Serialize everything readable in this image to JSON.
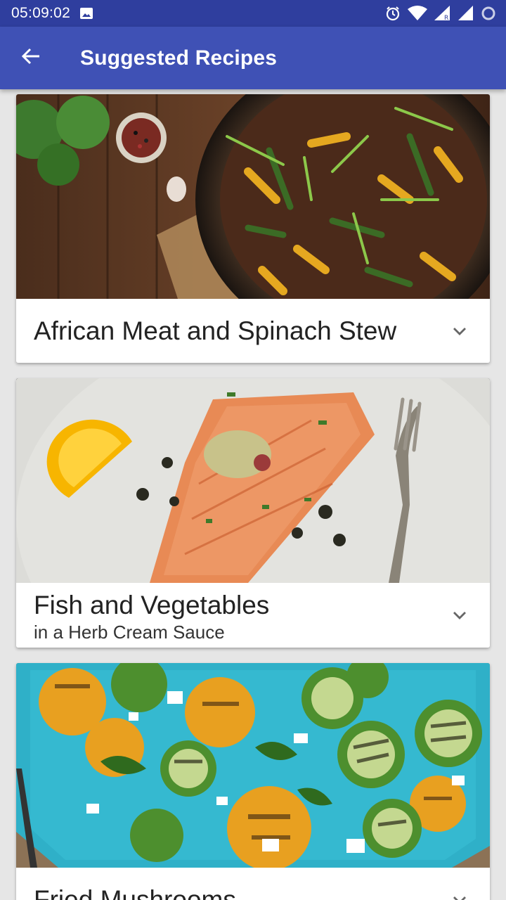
{
  "status_bar": {
    "time": "05:09:02",
    "icons": [
      "image-icon",
      "alarm-icon",
      "wifi-icon",
      "signal-r-icon",
      "signal-icon",
      "sync-circle-icon"
    ]
  },
  "app_bar": {
    "title": "Suggested Recipes",
    "back_icon": "arrow-back-icon"
  },
  "recipes": [
    {
      "title": "African Meat and Spinach Stew",
      "subtitle": "",
      "image": "beef-and-vegetable-stir-fry-photo",
      "expand_icon": "chevron-down-icon"
    },
    {
      "title": "Fish and Vegetables",
      "subtitle": "in a Herb Cream Sauce",
      "image": "grilled-salmon-with-lemon-photo",
      "expand_icon": "chevron-down-icon"
    },
    {
      "title": "Fried Mushrooms",
      "subtitle": "",
      "image": "grilled-zucchini-and-squash-photo",
      "expand_icon": "chevron-down-icon"
    }
  ],
  "colors": {
    "status_bar": "#2f3e9e",
    "app_bar": "#3f51b5",
    "background": "#e6e6e6",
    "card": "#ffffff"
  }
}
